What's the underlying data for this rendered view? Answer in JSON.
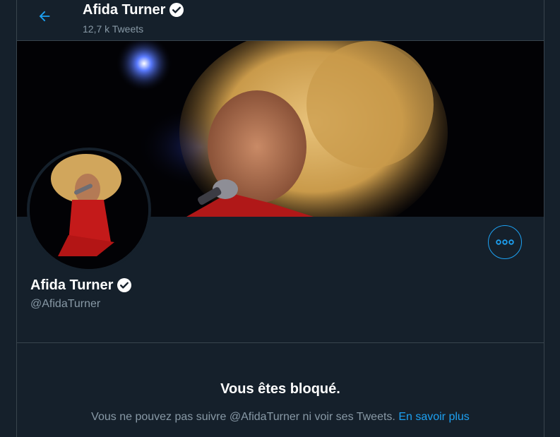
{
  "header": {
    "name": "Afida Turner",
    "tweet_count": "12,7 k Tweets",
    "back_icon": "arrow-left-icon"
  },
  "profile": {
    "name": "Afida Turner",
    "handle": "@AfidaTurner",
    "verified_icon": "verified-badge-icon",
    "more_icon": "more-horizontal-icon"
  },
  "blocked": {
    "title": "Vous êtes bloqué.",
    "message": "Vous ne pouvez pas suivre @AfidaTurner ni voir ses Tweets.",
    "link_label": "En savoir plus"
  },
  "colors": {
    "background": "#15202b",
    "border": "#38444d",
    "accent": "#1da1f2",
    "secondary_text": "#8899a6"
  }
}
